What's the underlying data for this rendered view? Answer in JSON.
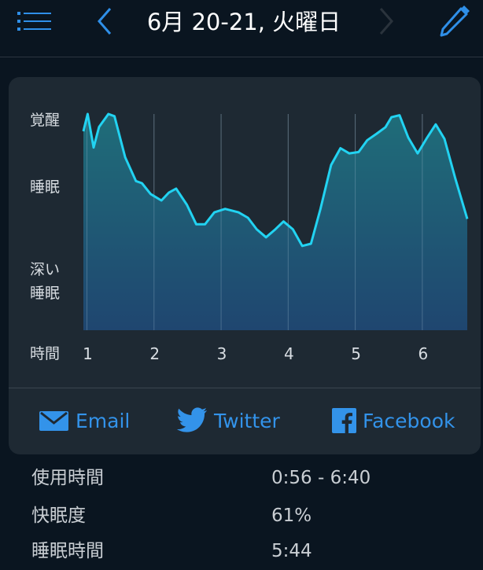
{
  "header": {
    "title": "6月 20-21, 火曜日",
    "menu_icon": "list-icon",
    "prev_icon": "chevron-left-icon",
    "next_icon": "chevron-right-icon",
    "edit_icon": "pencil-icon"
  },
  "colors": {
    "accent": "#2f8fe8",
    "line": "#22d3f2",
    "background": "#0a1520",
    "card": "#1e2933",
    "next_disabled": "#2a333c"
  },
  "chart_data": {
    "type": "area",
    "ylabels": {
      "awake": "覚醒",
      "sleep": "睡眠",
      "deep_sleep_1": "深い",
      "deep_sleep_2": "睡眠"
    },
    "xlabel": "時間",
    "xticks": [
      1,
      2,
      3,
      4,
      5,
      6
    ],
    "xlim": [
      0.947,
      6.67
    ],
    "ylim": [
      0,
      1
    ],
    "grid": "vertical",
    "x": [
      0.947,
      1.01,
      1.1,
      1.18,
      1.32,
      1.41,
      1.57,
      1.73,
      1.82,
      1.95,
      2.11,
      2.22,
      2.33,
      2.49,
      2.63,
      2.76,
      2.9,
      3.06,
      3.26,
      3.4,
      3.53,
      3.67,
      3.81,
      3.93,
      4.07,
      4.21,
      4.34,
      4.48,
      4.64,
      4.78,
      4.91,
      5.05,
      5.18,
      5.32,
      5.45,
      5.54,
      5.66,
      5.79,
      5.93,
      6.06,
      6.2,
      6.33,
      6.49,
      6.67
    ],
    "y": [
      0.92,
      1.0,
      0.845,
      0.94,
      1.0,
      0.99,
      0.8,
      0.69,
      0.68,
      0.63,
      0.6,
      0.636,
      0.655,
      0.58,
      0.49,
      0.49,
      0.545,
      0.561,
      0.545,
      0.52,
      0.467,
      0.43,
      0.467,
      0.503,
      0.467,
      0.39,
      0.4,
      0.56,
      0.764,
      0.842,
      0.818,
      0.824,
      0.879,
      0.909,
      0.939,
      0.985,
      0.994,
      0.891,
      0.818,
      0.885,
      0.952,
      0.885,
      0.703,
      0.515
    ]
  },
  "share": {
    "email": {
      "label": "Email",
      "icon": "envelope-icon"
    },
    "twitter": {
      "label": "Twitter",
      "icon": "twitter-bird-icon"
    },
    "facebook": {
      "label": "Facebook",
      "icon": "facebook-icon"
    }
  },
  "stats": [
    {
      "label": "使用時間",
      "value": "0:56 - 6:40"
    },
    {
      "label": "快眠度",
      "value": "61%"
    },
    {
      "label": "睡眠時間",
      "value": "5:44"
    }
  ]
}
